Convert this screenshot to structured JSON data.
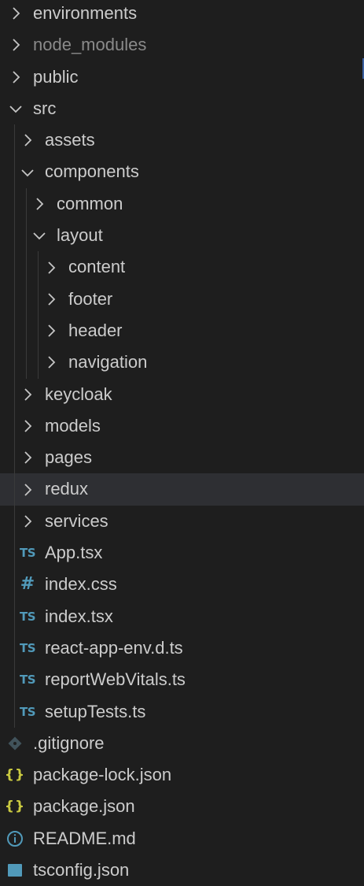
{
  "explorer": {
    "items": [
      {
        "label": "environments",
        "depth": 0,
        "type": "folder",
        "expanded": false
      },
      {
        "label": "node_modules",
        "depth": 0,
        "type": "folder",
        "expanded": false,
        "dimmed": true
      },
      {
        "label": "public",
        "depth": 0,
        "type": "folder",
        "expanded": false
      },
      {
        "label": "src",
        "depth": 0,
        "type": "folder",
        "expanded": true
      },
      {
        "label": "assets",
        "depth": 1,
        "type": "folder",
        "expanded": false
      },
      {
        "label": "components",
        "depth": 1,
        "type": "folder",
        "expanded": true
      },
      {
        "label": "common",
        "depth": 2,
        "type": "folder",
        "expanded": false
      },
      {
        "label": "layout",
        "depth": 2,
        "type": "folder",
        "expanded": true
      },
      {
        "label": "content",
        "depth": 3,
        "type": "folder",
        "expanded": false
      },
      {
        "label": "footer",
        "depth": 3,
        "type": "folder",
        "expanded": false
      },
      {
        "label": "header",
        "depth": 3,
        "type": "folder",
        "expanded": false
      },
      {
        "label": "navigation",
        "depth": 3,
        "type": "folder",
        "expanded": false
      },
      {
        "label": "keycloak",
        "depth": 1,
        "type": "folder",
        "expanded": false
      },
      {
        "label": "models",
        "depth": 1,
        "type": "folder",
        "expanded": false
      },
      {
        "label": "pages",
        "depth": 1,
        "type": "folder",
        "expanded": false
      },
      {
        "label": "redux",
        "depth": 1,
        "type": "folder",
        "expanded": false,
        "hovered": true
      },
      {
        "label": "services",
        "depth": 1,
        "type": "folder",
        "expanded": false
      },
      {
        "label": "App.tsx",
        "depth": 1,
        "type": "file",
        "icon": "ts",
        "icon_text": "TS"
      },
      {
        "label": "index.css",
        "depth": 1,
        "type": "file",
        "icon": "css",
        "icon_text": "#"
      },
      {
        "label": "index.tsx",
        "depth": 1,
        "type": "file",
        "icon": "ts",
        "icon_text": "TS"
      },
      {
        "label": "react-app-env.d.ts",
        "depth": 1,
        "type": "file",
        "icon": "ts",
        "icon_text": "TS"
      },
      {
        "label": "reportWebVitals.ts",
        "depth": 1,
        "type": "file",
        "icon": "ts",
        "icon_text": "TS"
      },
      {
        "label": "setupTests.ts",
        "depth": 1,
        "type": "file",
        "icon": "ts",
        "icon_text": "TS"
      },
      {
        "label": ".gitignore",
        "depth": 0,
        "type": "file",
        "icon": "git"
      },
      {
        "label": "package-lock.json",
        "depth": 0,
        "type": "file",
        "icon": "json",
        "icon_text": "{}"
      },
      {
        "label": "package.json",
        "depth": 0,
        "type": "file",
        "icon": "json",
        "icon_text": "{}"
      },
      {
        "label": "README.md",
        "depth": 0,
        "type": "file",
        "icon": "info"
      },
      {
        "label": "tsconfig.json",
        "depth": 0,
        "type": "file",
        "icon": "tsconfig"
      }
    ]
  },
  "colors": {
    "background": "#1e1e1e",
    "text": "#cccccc",
    "dimmed_text": "#8a8a8a",
    "hover_row": "#2e2f33",
    "ts_icon": "#519aba",
    "json_icon": "#cbcb41",
    "git_icon": "#41535b",
    "info_icon": "#519aba"
  }
}
